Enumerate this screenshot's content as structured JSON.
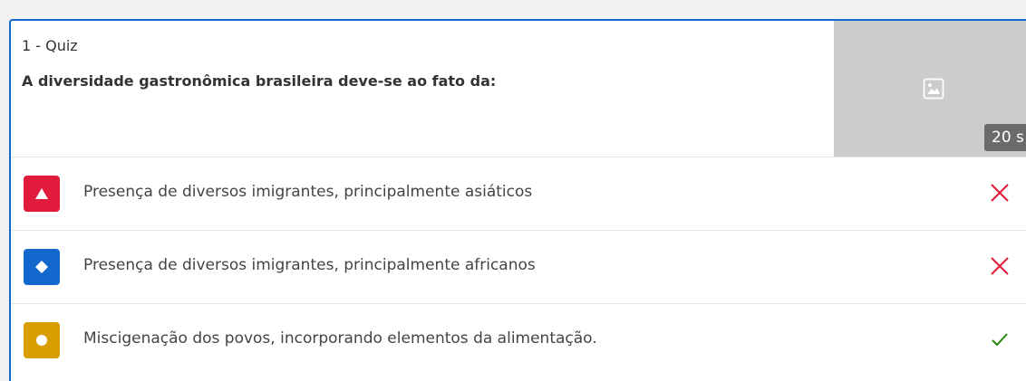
{
  "question": {
    "label": "1 - Quiz",
    "text": "A diversidade gastronômica brasileira deve-se ao fato da:",
    "media_icon": "image-icon",
    "timer": "20 s"
  },
  "answers": [
    {
      "shape": "triangle",
      "color": "#e21b3c",
      "text": "Presença de diversos imigrantes, principalmente asiáticos",
      "status": "incorrect"
    },
    {
      "shape": "diamond",
      "color": "#1368ce",
      "text": "Presença de diversos imigrantes, principalmente africanos",
      "status": "incorrect"
    },
    {
      "shape": "circle",
      "color": "#d89e00",
      "text": "Miscigenação dos povos, incorporando elementos da alimentação.",
      "status": "correct"
    }
  ],
  "colors": {
    "accent": "#1368ce",
    "incorrect": "#e21b3c",
    "correct": "#26890c"
  }
}
